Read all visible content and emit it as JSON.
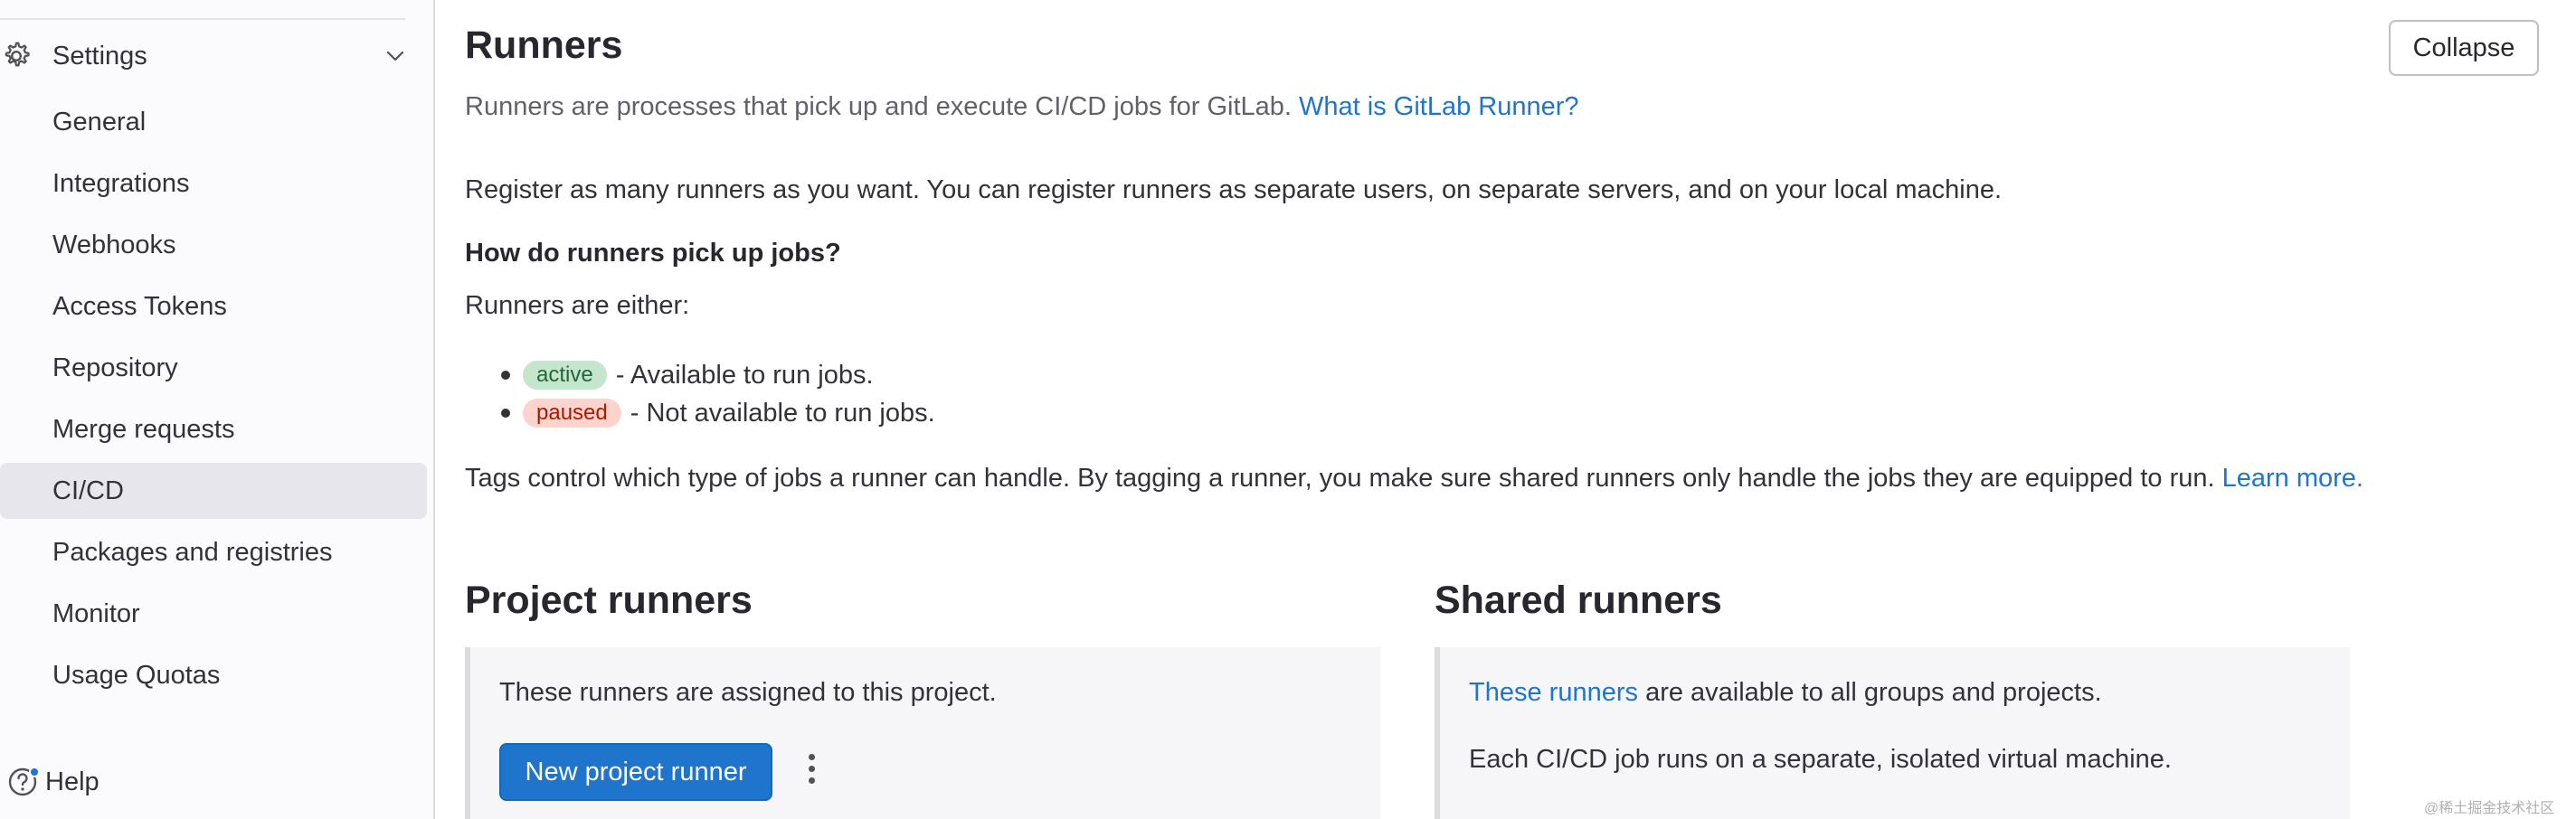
{
  "sidebar": {
    "settings_label": "Settings",
    "items": [
      {
        "label": "General"
      },
      {
        "label": "Integrations"
      },
      {
        "label": "Webhooks"
      },
      {
        "label": "Access Tokens"
      },
      {
        "label": "Repository"
      },
      {
        "label": "Merge requests"
      },
      {
        "label": "CI/CD",
        "active": true
      },
      {
        "label": "Packages and registries"
      },
      {
        "label": "Monitor"
      },
      {
        "label": "Usage Quotas"
      }
    ],
    "help_label": "Help"
  },
  "main": {
    "title": "Runners",
    "collapse_label": "Collapse",
    "intro_text": "Runners are processes that pick up and execute CI/CD jobs for GitLab.",
    "intro_link": "What is GitLab Runner?",
    "register_text": "Register as many runners as you want. You can register runners as separate users, on separate servers, and on your local machine.",
    "jobs_heading": "How do runners pick up jobs?",
    "either_text": "Runners are either:",
    "states": [
      {
        "badge": "active",
        "text": "- Available to run jobs."
      },
      {
        "badge": "paused",
        "text": "- Not available to run jobs."
      }
    ],
    "tags_text": "Tags control which type of jobs a runner can handle. By tagging a runner, you make sure shared runners only handle the jobs they are equipped to run.",
    "tags_link": "Learn more.",
    "project_runners": {
      "title": "Project runners",
      "description": "These runners are assigned to this project.",
      "new_button": "New project runner"
    },
    "shared_runners": {
      "title": "Shared runners",
      "link": "These runners",
      "description_rest": "are available to all groups and projects.",
      "vm_text": "Each CI/CD job runs on a separate, isolated virtual machine."
    }
  },
  "watermark": "@稀土掘金技术社区",
  "colors": {
    "link": "#1f75cb",
    "primary": "#1f75cb",
    "active_badge_bg": "#c3e6cd",
    "paused_badge_bg": "#fdd4cd"
  },
  "icons": {
    "settings": "gear-icon",
    "expand": "chevron-down-icon",
    "help": "help-icon",
    "more": "kebab-icon"
  }
}
